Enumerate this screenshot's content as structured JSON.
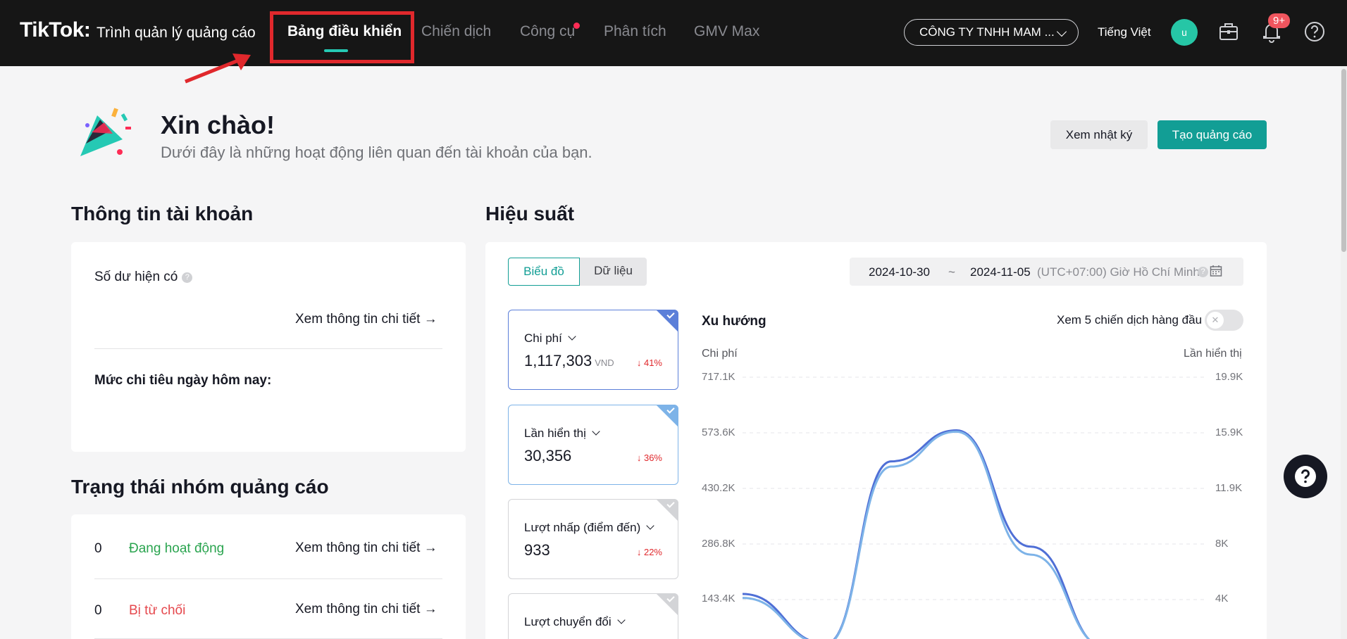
{
  "header": {
    "logo": "TikTok",
    "logo_sub": "Trình quản lý quảng cáo",
    "nav": [
      "Bảng điều khiển",
      "Chiến dịch",
      "Công cụ",
      "Phân tích",
      "GMV Max"
    ],
    "company": "CÔNG TY TNHH MAM ...",
    "language": "Tiếng Việt",
    "avatar_letter": "u",
    "notification_badge": "9+"
  },
  "greeting": {
    "title": "Xin chào!",
    "subtitle": "Dưới đây là những hoạt động liên quan đến tài khoản của bạn.",
    "log_button": "Xem nhật ký",
    "create_button": "Tạo quảng cáo"
  },
  "account": {
    "heading": "Thông tin tài khoản",
    "balance_label": "Số dư hiện có",
    "details_link": "Xem thông tin chi tiết",
    "spend_today_label": "Mức chi tiêu ngày hôm nay:"
  },
  "adgroup_status": {
    "heading": "Trạng thái nhóm quảng cáo",
    "rows": [
      {
        "count": "0",
        "status": "Đang hoạt động",
        "color": "#2aa44f",
        "link": "Xem thông tin chi tiết"
      },
      {
        "count": "0",
        "status": "Bị từ chối",
        "color": "#e5484d",
        "link": "Xem thông tin chi tiết"
      }
    ]
  },
  "performance": {
    "heading": "Hiệu suất",
    "tab_chart": "Biểu đồ",
    "tab_data": "Dữ liệu",
    "date_start": "2024-10-30",
    "date_sep": "~",
    "date_end": "2024-11-05",
    "timezone": "(UTC+07:00) Giờ Hồ Chí Minh",
    "metrics": [
      {
        "name": "Chi phí",
        "value": "1,117,303",
        "unit": "VND",
        "change": "41%",
        "accent": "#5b7fd9"
      },
      {
        "name": "Lần hiển thị",
        "value": "30,356",
        "unit": "",
        "change": "36%",
        "accent": "#7db3e8"
      },
      {
        "name": "Lượt nhấp (điểm đến)",
        "value": "933",
        "unit": "",
        "change": "22%",
        "accent": "#d3d4d7"
      },
      {
        "name": "Lượt chuyển đổi",
        "value": "",
        "unit": "",
        "change": "",
        "accent": "#d3d4d7"
      }
    ],
    "trend_title": "Xu hướng",
    "top5_label": "Xem 5 chiến dịch hàng đầu"
  },
  "chart_data": {
    "type": "line",
    "ylabel_left": "Chi phí",
    "ylabel_right": "Lần hiển thị",
    "yticks_left": [
      "717.1K",
      "573.6K",
      "430.2K",
      "286.8K",
      "143.4K"
    ],
    "yticks_right": [
      "19.9K",
      "15.9K",
      "11.9K",
      "8K",
      "4K"
    ],
    "ylim_left": [
      0,
      717100
    ],
    "ylim_right": [
      0,
      19900
    ],
    "grid": true,
    "series": [
      {
        "name": "Chi phí",
        "axis": "left",
        "color": "#4f6fd6",
        "values": [
          [
            0,
            158000
          ],
          [
            0.18,
            30000
          ],
          [
            0.32,
            500000
          ],
          [
            0.46,
            580000
          ],
          [
            0.62,
            280000
          ],
          [
            0.78,
            20000
          ]
        ]
      },
      {
        "name": "Lần hiển thị",
        "axis": "right",
        "color": "#7db3e8",
        "values": [
          [
            0,
            4100
          ],
          [
            0.18,
            800
          ],
          [
            0.32,
            13500
          ],
          [
            0.46,
            16000
          ],
          [
            0.62,
            7200
          ],
          [
            0.78,
            600
          ]
        ]
      }
    ]
  }
}
